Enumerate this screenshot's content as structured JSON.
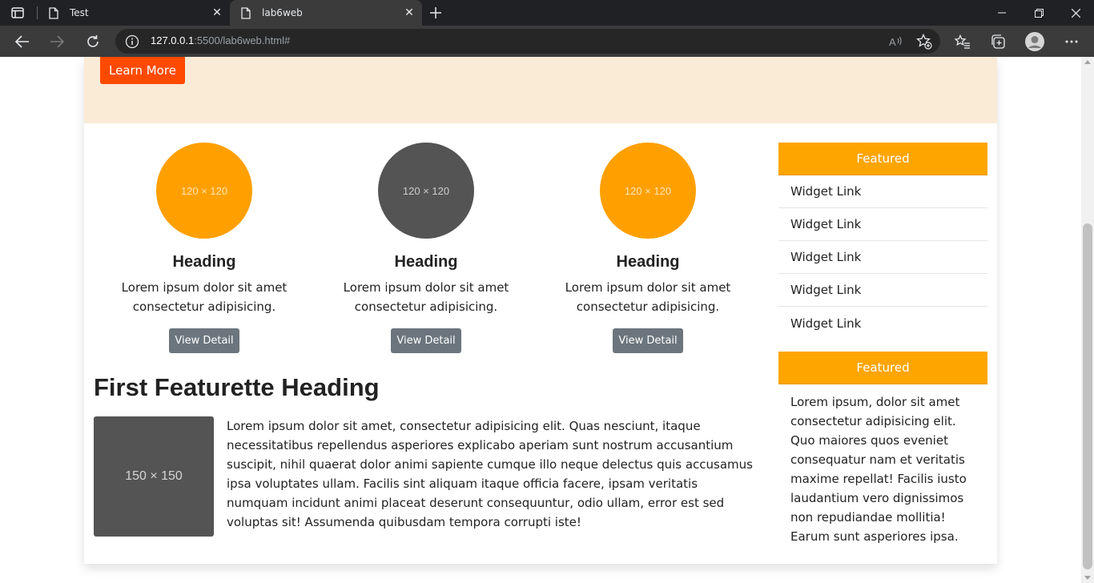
{
  "browser": {
    "tabs": [
      {
        "title": "Test"
      },
      {
        "title": "lab6web"
      }
    ],
    "url_host": "127.0.0.1",
    "url_rest": ":5500/lab6web.html#"
  },
  "hero": {
    "button_label": "Learn More"
  },
  "columns": [
    {
      "placeholder": "120 × 120",
      "heading": "Heading",
      "text": "Lorem ipsum dolor sit amet consectetur adipisicing.",
      "button_label": "View Detail",
      "circle_color": "#ffa000"
    },
    {
      "placeholder": "120 × 120",
      "heading": "Heading",
      "text": "Lorem ipsum dolor sit amet consectetur adipisicing.",
      "button_label": "View Detail",
      "circle_color": "#545454"
    },
    {
      "placeholder": "120 × 120",
      "heading": "Heading",
      "text": "Lorem ipsum dolor sit amet consectetur adipisicing.",
      "button_label": "View Detail",
      "circle_color": "#ffa000"
    }
  ],
  "featurette": {
    "heading": "First Featurette Heading",
    "image_placeholder": "150 × 150",
    "text": "Lorem ipsum dolor sit amet, consectetur adipisicing elit. Quas nesciunt, itaque necessitatibus repellendus asperiores explicabo aperiam sunt nostrum accusantium suscipit, nihil quaerat dolor animi sapiente cumque illo neque delectus quis accusamus ipsa voluptates ullam. Facilis sint aliquam itaque officia facere, ipsam veritatis numquam incidunt animi placeat deserunt consequuntur, odio ullam, error est sed voluptas sit! Assumenda quibusdam tempora corrupti iste!"
  },
  "sidebar": {
    "widget1": {
      "title": "Featured",
      "links": [
        "Widget Link",
        "Widget Link",
        "Widget Link",
        "Widget Link",
        "Widget Link"
      ]
    },
    "widget2": {
      "title": "Featured",
      "text": "Lorem ipsum, dolor sit amet consectetur adipisicing elit. Quo maiores quos eveniet consequatur nam et veritatis maxime repellat! Facilis iusto laudantium vero dignissimos non repudiandae mollitia! Earum sunt asperiores ipsa."
    }
  },
  "colors": {
    "accent_orange": "#ffa500",
    "learn_more": "#ff4a00",
    "hero_bg": "#faebd7",
    "button_gray": "#6c757d"
  }
}
